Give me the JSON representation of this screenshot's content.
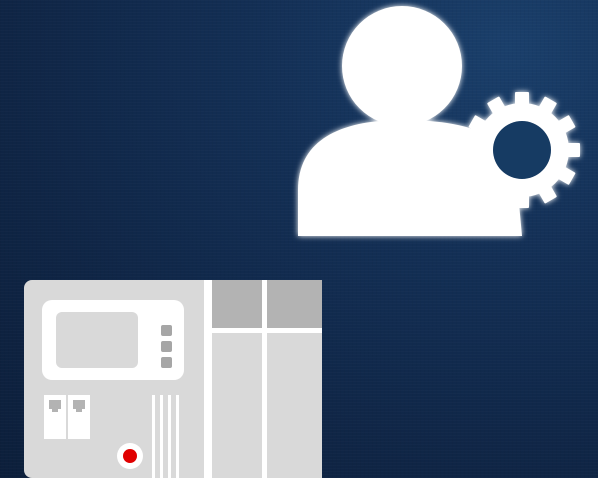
{
  "icons": {
    "user_admin": "user-settings-icon",
    "gear": "gear-icon",
    "device": "control-cabinet-icon",
    "status_led": "status-led-icon",
    "ethernet_ports": "ethernet-port-icon"
  },
  "colors": {
    "background_top": "#1a3f6b",
    "background_bottom": "#0c1f3b",
    "icon_white": "#ffffff",
    "device_body": "#d9d9d9",
    "device_dark_panel": "#b3b3b3",
    "device_light": "#e6e6e6",
    "led_red": "#e00000"
  }
}
